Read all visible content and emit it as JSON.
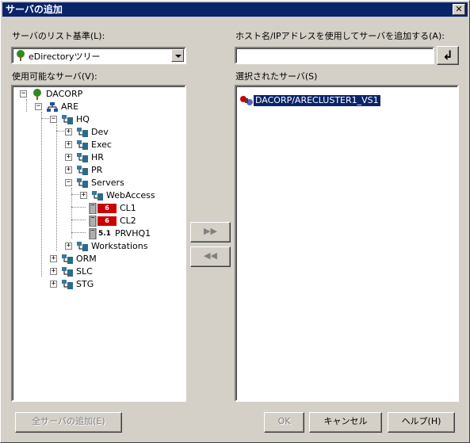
{
  "window": {
    "title": "サーバの追加"
  },
  "left": {
    "list_basis_label": "サーバのリスト基準(L):",
    "combo_value": "eDirectoryツリー",
    "available_label": "使用可能なサーバ(V):"
  },
  "right": {
    "host_label": "ホスト名/IPアドレスを使用してサーバを追加する(A):",
    "host_value": "",
    "selected_label": "選択されたサーバ(S)",
    "selected_items": [
      "DACORP/ARECLUSTER1_VS1"
    ]
  },
  "tree": {
    "root": "DACORP",
    "are": "ARE",
    "hq": "HQ",
    "dev": "Dev",
    "exec": "Exec",
    "hr": "HR",
    "pr": "PR",
    "servers": "Servers",
    "webaccess": "WebAccess",
    "cl1": "CL1",
    "cl2": "CL2",
    "prvhq1": "PRVHQ1",
    "workstations": "Workstations",
    "orm": "ORM",
    "slc": "SLC",
    "stg": "STG",
    "badge6": "6",
    "badge51": "5.1"
  },
  "buttons": {
    "add_all": "全サーバの追加(E)",
    "ok": "OK",
    "cancel": "キャンセル",
    "help": "ヘルプ(H)",
    "move_right": "▶▶",
    "move_left": "◀◀",
    "enter": "↲"
  },
  "colors": {
    "titlebar": "#0a246a",
    "selection": "#0a246a",
    "badge": "#cc0000"
  }
}
